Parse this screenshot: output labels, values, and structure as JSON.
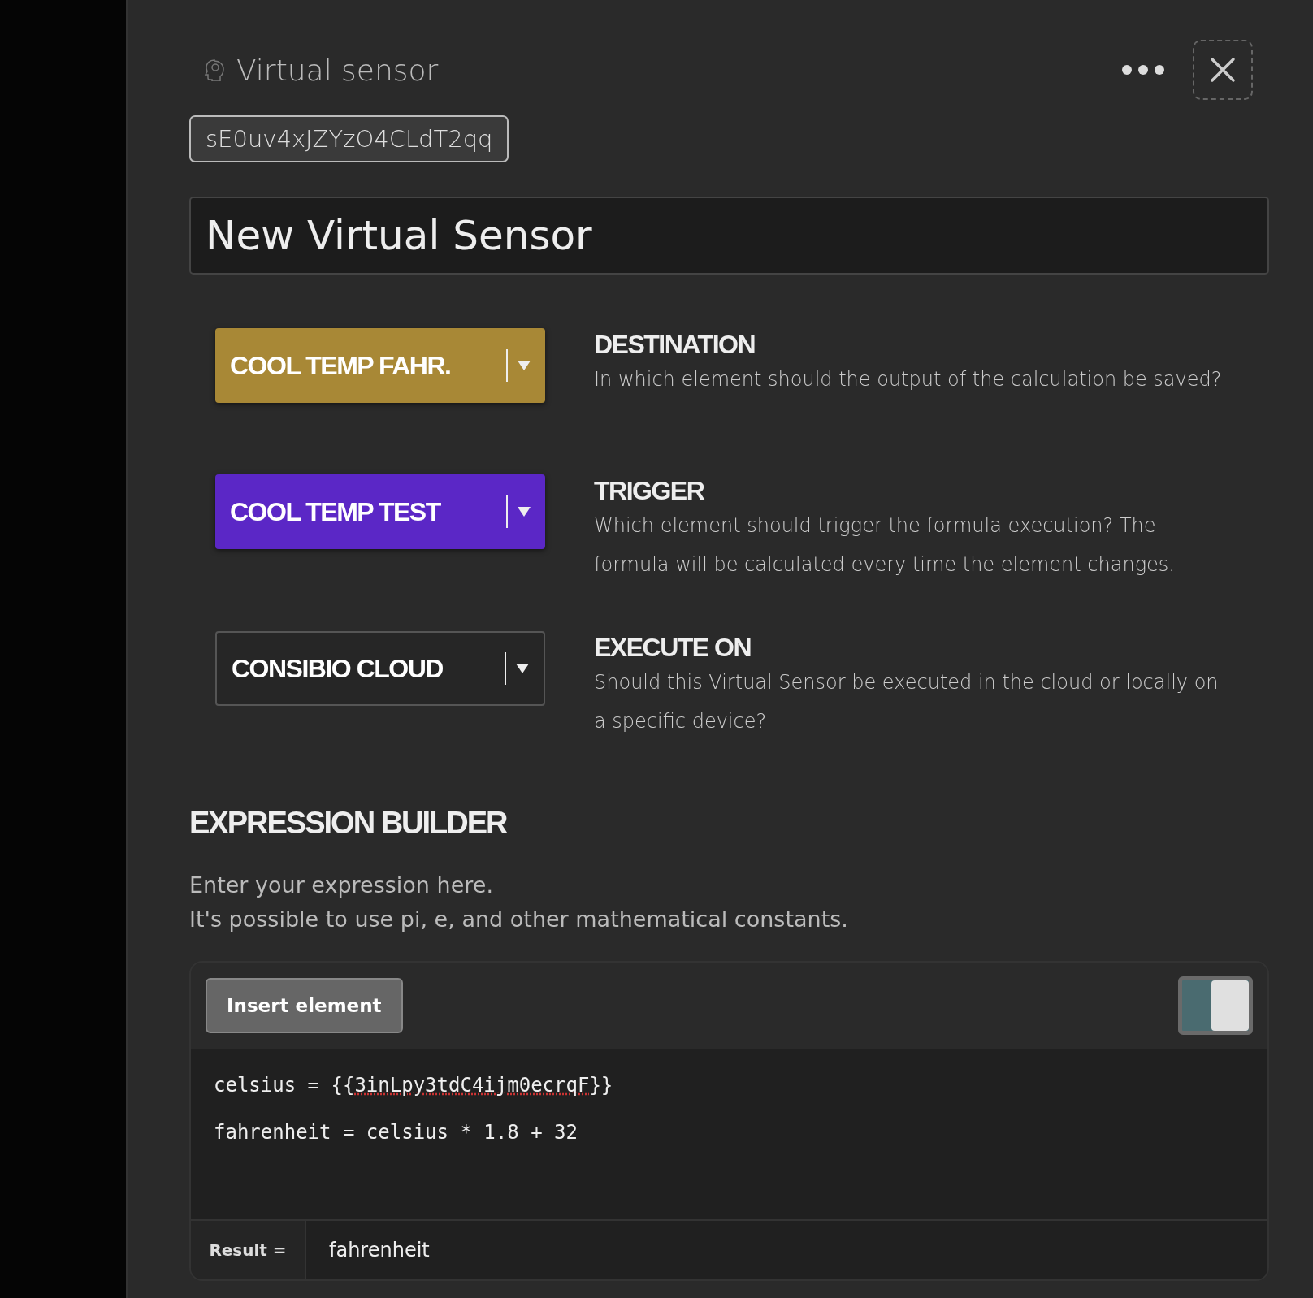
{
  "header": {
    "title": "Virtual sensor",
    "id_badge": "sE0uv4xJZYzO4CLdT2qq"
  },
  "name_field": {
    "value": "New Virtual Sensor"
  },
  "settings": [
    {
      "kind": "filled",
      "color": "#a88836",
      "value": "COOL TEMP FAHR.",
      "heading": "DESTINATION",
      "description": "In which element should the output of the calculation be saved?"
    },
    {
      "kind": "filled",
      "color": "#5b27c6",
      "value": "COOL TEMP TEST",
      "heading": "TRIGGER",
      "description": "Which element should trigger the formula execution? The formula will be calculated every time the element changes."
    },
    {
      "kind": "outlined",
      "value": "CONSIBIO CLOUD",
      "heading": "EXECUTE ON",
      "description": "Should this Virtual Sensor be executed in the cloud or locally on a specific device?"
    }
  ],
  "expression_builder": {
    "heading": "EXPRESSION BUILDER",
    "intro": [
      "Enter your expression here.",
      "It's possible to use pi, e, and other mathematical constants."
    ],
    "insert_button": "Insert element",
    "toggle": {
      "on": true
    },
    "code_lines": [
      [
        {
          "text": "celsius = {{"
        },
        {
          "text": "3inLpy3tdC4ijm0ecrqF",
          "misspelled": true
        },
        {
          "text": "}}"
        }
      ],
      [
        {
          "text": "fahrenheit = celsius * 1.8 + 32"
        }
      ]
    ],
    "result_label": "Result =",
    "result_value": "fahrenheit"
  }
}
